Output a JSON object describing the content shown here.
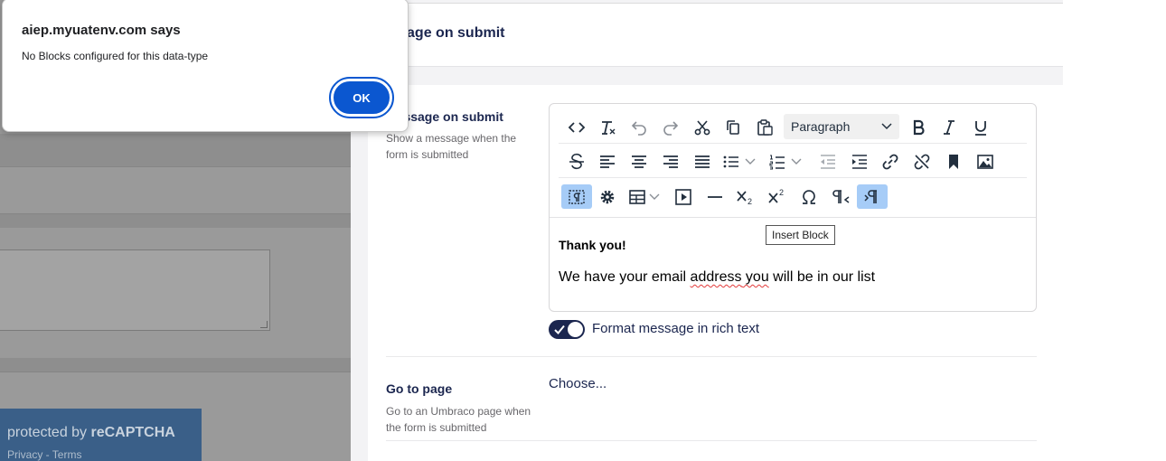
{
  "dialog": {
    "title": "aiep.myuatenv.com says",
    "message": "No Blocks configured for this data-type",
    "ok_label": "OK"
  },
  "background": {
    "recaptcha_prefix": "protected by ",
    "recaptcha_brand": "reCAPTCHA",
    "recaptcha_links": "Privacy - Terms"
  },
  "panel": {
    "title": "Message on submit",
    "message_prop": {
      "label": "Message on submit",
      "description": "Show a message when the form is submitted"
    },
    "editor": {
      "block_format": "Paragraph",
      "tooltip": "Insert Block",
      "content_heading": "Thank you!",
      "content_line_parts": [
        "We have your email ",
        "address",
        " you",
        " will be in our list"
      ]
    },
    "toggle": {
      "label": "Format message in rich text",
      "checked": true
    },
    "goto_prop": {
      "label": "Go to page",
      "description": "Go to an Umbraco page when the form is submitted",
      "value": "Choose..."
    }
  },
  "colors": {
    "umbraco_navy": "#1b264f",
    "dialog_button": "#0b57d0",
    "toolbar_active": "#a6ccf7"
  }
}
